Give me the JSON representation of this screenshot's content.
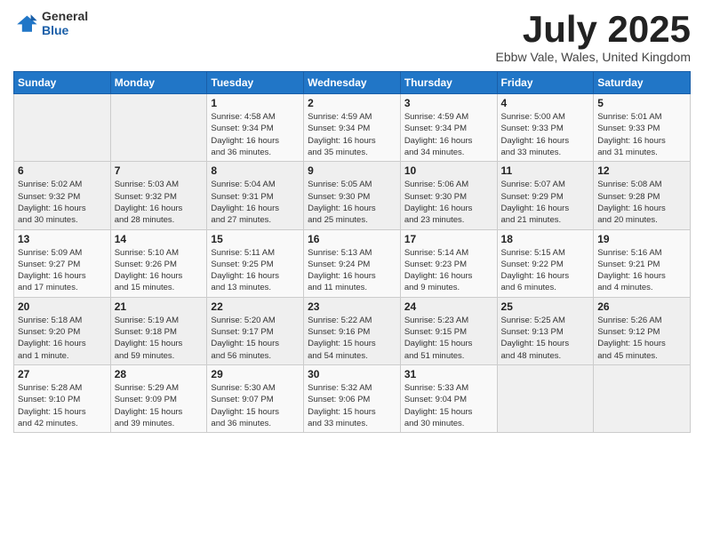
{
  "logo": {
    "general": "General",
    "blue": "Blue"
  },
  "title": {
    "month": "July 2025",
    "location": "Ebbw Vale, Wales, United Kingdom"
  },
  "headers": [
    "Sunday",
    "Monday",
    "Tuesday",
    "Wednesday",
    "Thursday",
    "Friday",
    "Saturday"
  ],
  "weeks": [
    [
      {
        "day": "",
        "info": ""
      },
      {
        "day": "",
        "info": ""
      },
      {
        "day": "1",
        "info": "Sunrise: 4:58 AM\nSunset: 9:34 PM\nDaylight: 16 hours\nand 36 minutes."
      },
      {
        "day": "2",
        "info": "Sunrise: 4:59 AM\nSunset: 9:34 PM\nDaylight: 16 hours\nand 35 minutes."
      },
      {
        "day": "3",
        "info": "Sunrise: 4:59 AM\nSunset: 9:34 PM\nDaylight: 16 hours\nand 34 minutes."
      },
      {
        "day": "4",
        "info": "Sunrise: 5:00 AM\nSunset: 9:33 PM\nDaylight: 16 hours\nand 33 minutes."
      },
      {
        "day": "5",
        "info": "Sunrise: 5:01 AM\nSunset: 9:33 PM\nDaylight: 16 hours\nand 31 minutes."
      }
    ],
    [
      {
        "day": "6",
        "info": "Sunrise: 5:02 AM\nSunset: 9:32 PM\nDaylight: 16 hours\nand 30 minutes."
      },
      {
        "day": "7",
        "info": "Sunrise: 5:03 AM\nSunset: 9:32 PM\nDaylight: 16 hours\nand 28 minutes."
      },
      {
        "day": "8",
        "info": "Sunrise: 5:04 AM\nSunset: 9:31 PM\nDaylight: 16 hours\nand 27 minutes."
      },
      {
        "day": "9",
        "info": "Sunrise: 5:05 AM\nSunset: 9:30 PM\nDaylight: 16 hours\nand 25 minutes."
      },
      {
        "day": "10",
        "info": "Sunrise: 5:06 AM\nSunset: 9:30 PM\nDaylight: 16 hours\nand 23 minutes."
      },
      {
        "day": "11",
        "info": "Sunrise: 5:07 AM\nSunset: 9:29 PM\nDaylight: 16 hours\nand 21 minutes."
      },
      {
        "day": "12",
        "info": "Sunrise: 5:08 AM\nSunset: 9:28 PM\nDaylight: 16 hours\nand 20 minutes."
      }
    ],
    [
      {
        "day": "13",
        "info": "Sunrise: 5:09 AM\nSunset: 9:27 PM\nDaylight: 16 hours\nand 17 minutes."
      },
      {
        "day": "14",
        "info": "Sunrise: 5:10 AM\nSunset: 9:26 PM\nDaylight: 16 hours\nand 15 minutes."
      },
      {
        "day": "15",
        "info": "Sunrise: 5:11 AM\nSunset: 9:25 PM\nDaylight: 16 hours\nand 13 minutes."
      },
      {
        "day": "16",
        "info": "Sunrise: 5:13 AM\nSunset: 9:24 PM\nDaylight: 16 hours\nand 11 minutes."
      },
      {
        "day": "17",
        "info": "Sunrise: 5:14 AM\nSunset: 9:23 PM\nDaylight: 16 hours\nand 9 minutes."
      },
      {
        "day": "18",
        "info": "Sunrise: 5:15 AM\nSunset: 9:22 PM\nDaylight: 16 hours\nand 6 minutes."
      },
      {
        "day": "19",
        "info": "Sunrise: 5:16 AM\nSunset: 9:21 PM\nDaylight: 16 hours\nand 4 minutes."
      }
    ],
    [
      {
        "day": "20",
        "info": "Sunrise: 5:18 AM\nSunset: 9:20 PM\nDaylight: 16 hours\nand 1 minute."
      },
      {
        "day": "21",
        "info": "Sunrise: 5:19 AM\nSunset: 9:18 PM\nDaylight: 15 hours\nand 59 minutes."
      },
      {
        "day": "22",
        "info": "Sunrise: 5:20 AM\nSunset: 9:17 PM\nDaylight: 15 hours\nand 56 minutes."
      },
      {
        "day": "23",
        "info": "Sunrise: 5:22 AM\nSunset: 9:16 PM\nDaylight: 15 hours\nand 54 minutes."
      },
      {
        "day": "24",
        "info": "Sunrise: 5:23 AM\nSunset: 9:15 PM\nDaylight: 15 hours\nand 51 minutes."
      },
      {
        "day": "25",
        "info": "Sunrise: 5:25 AM\nSunset: 9:13 PM\nDaylight: 15 hours\nand 48 minutes."
      },
      {
        "day": "26",
        "info": "Sunrise: 5:26 AM\nSunset: 9:12 PM\nDaylight: 15 hours\nand 45 minutes."
      }
    ],
    [
      {
        "day": "27",
        "info": "Sunrise: 5:28 AM\nSunset: 9:10 PM\nDaylight: 15 hours\nand 42 minutes."
      },
      {
        "day": "28",
        "info": "Sunrise: 5:29 AM\nSunset: 9:09 PM\nDaylight: 15 hours\nand 39 minutes."
      },
      {
        "day": "29",
        "info": "Sunrise: 5:30 AM\nSunset: 9:07 PM\nDaylight: 15 hours\nand 36 minutes."
      },
      {
        "day": "30",
        "info": "Sunrise: 5:32 AM\nSunset: 9:06 PM\nDaylight: 15 hours\nand 33 minutes."
      },
      {
        "day": "31",
        "info": "Sunrise: 5:33 AM\nSunset: 9:04 PM\nDaylight: 15 hours\nand 30 minutes."
      },
      {
        "day": "",
        "info": ""
      },
      {
        "day": "",
        "info": ""
      }
    ]
  ]
}
